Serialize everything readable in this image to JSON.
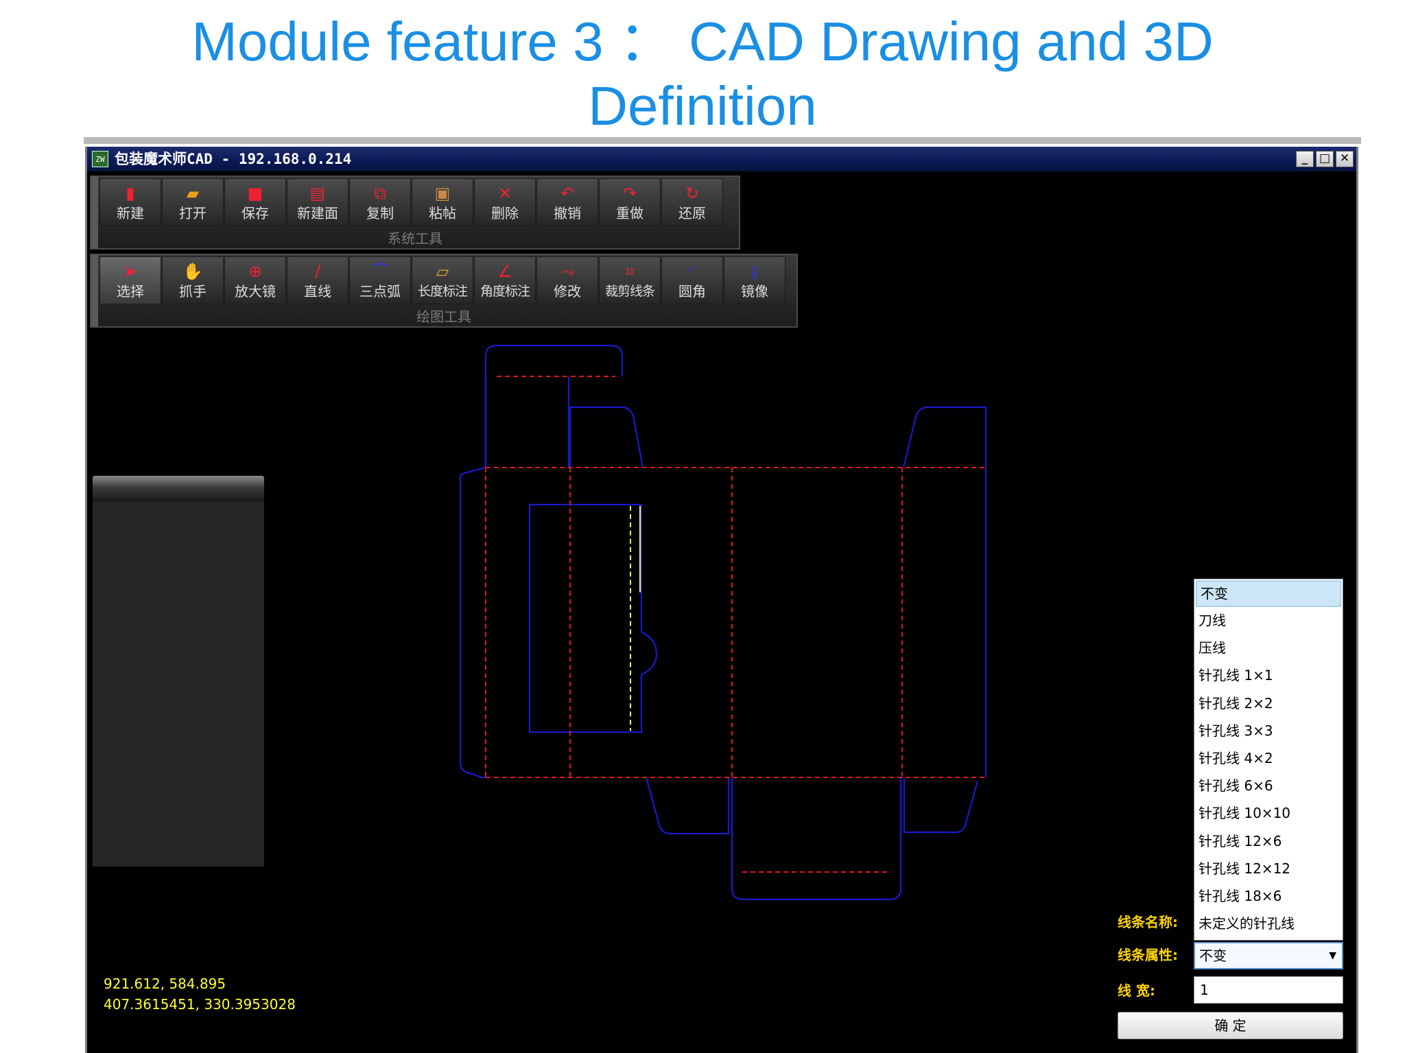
{
  "slide": {
    "title_line1": "Module feature 3 ：  CAD Drawing and 3D",
    "title_line2": "Definition"
  },
  "window": {
    "icon_text": "ZW",
    "title": "包装魔术师CAD  - 192.168.0.214",
    "buttons": [
      "_",
      "□",
      "✕"
    ]
  },
  "system_toolbar": {
    "caption": "系统工具",
    "tools": [
      {
        "label": "新建",
        "icon": "new-file-icon"
      },
      {
        "label": "打开",
        "icon": "open-folder-icon"
      },
      {
        "label": "保存",
        "icon": "save-icon"
      },
      {
        "label": "新建面",
        "icon": "new-face-icon"
      },
      {
        "label": "复制",
        "icon": "copy-icon"
      },
      {
        "label": "粘帖",
        "icon": "paste-icon"
      },
      {
        "label": "删除",
        "icon": "delete-icon"
      },
      {
        "label": "撤销",
        "icon": "undo-icon"
      },
      {
        "label": "重做",
        "icon": "redo-icon"
      },
      {
        "label": "还原",
        "icon": "restore-icon"
      }
    ]
  },
  "drawing_toolbar": {
    "caption": "绘图工具",
    "tools": [
      {
        "label": "选择",
        "icon": "select-arrow-icon"
      },
      {
        "label": "抓手",
        "icon": "hand-icon"
      },
      {
        "label": "放大镜",
        "icon": "magnifier-icon"
      },
      {
        "label": "直线",
        "icon": "line-icon"
      },
      {
        "label": "三点弧",
        "icon": "arc-icon"
      },
      {
        "label": "长度标注",
        "icon": "ruler-icon"
      },
      {
        "label": "角度标注",
        "icon": "angle-icon"
      },
      {
        "label": "修改",
        "icon": "modify-icon"
      },
      {
        "label": "裁剪线条",
        "icon": "crop-icon"
      },
      {
        "label": "圆角",
        "icon": "fillet-icon"
      },
      {
        "label": "镜像",
        "icon": "mirror-icon"
      }
    ]
  },
  "coordinates": {
    "line1": "921.612, 584.895",
    "line2": "407.3615451, 330.3953028"
  },
  "line_type_dropdown": {
    "options": [
      "不变",
      "刀线",
      "压线",
      "针孔线 1×1",
      "针孔线 2×2",
      "针孔线 3×3",
      "针孔线 4×2",
      "针孔线 6×6",
      "针孔线 10×10",
      "针孔线 12×6",
      "针孔线 12×12",
      "针孔线 18×6",
      "未定义的针孔线"
    ],
    "selected": "不变"
  },
  "properties": {
    "name_label": "线条名称:",
    "attr_label": "线条属性:",
    "attr_value": "不变",
    "width_label": "线  宽:",
    "width_value": "1",
    "ok_label": "确  定"
  },
  "colors": {
    "title_blue": "#1a8fe3",
    "cut_line": "#1a1acc",
    "crease_line": "#e01818",
    "highlight_line": "#ffff33",
    "prop_label": "#ffd400"
  }
}
